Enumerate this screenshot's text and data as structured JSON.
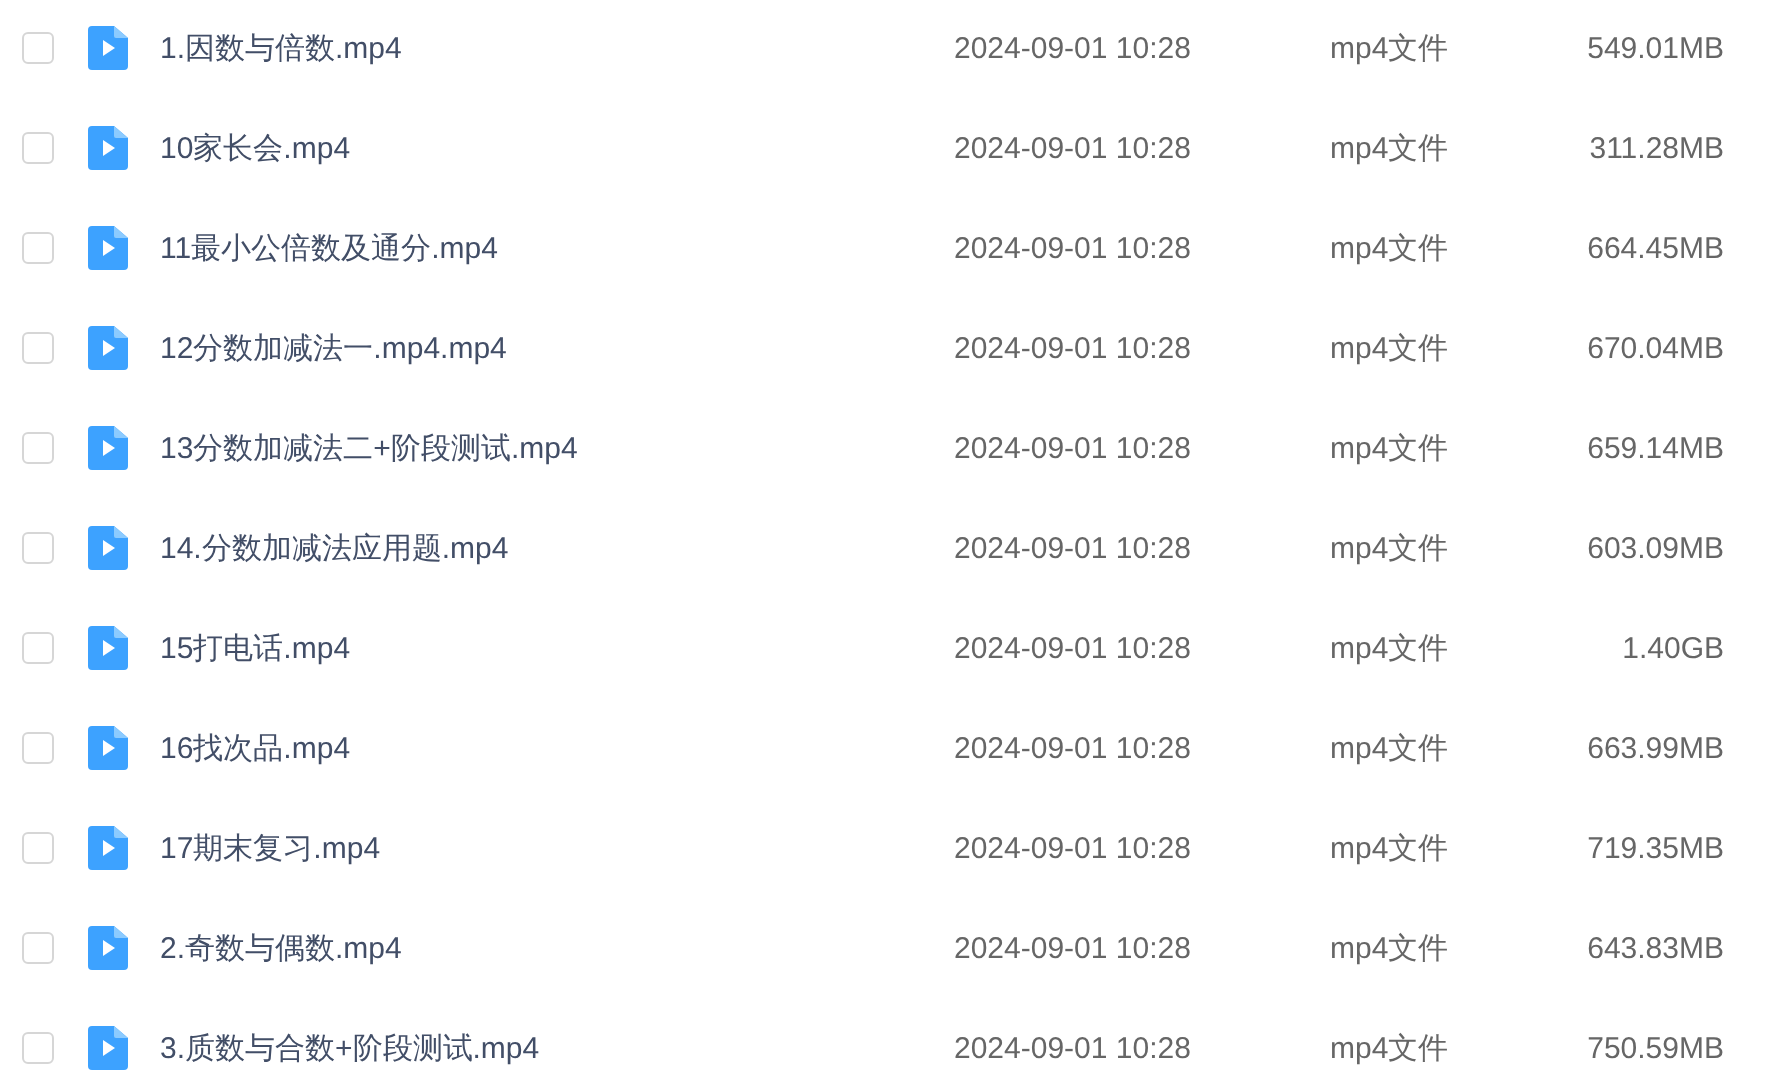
{
  "files": [
    {
      "name": "1.因数与倍数.mp4",
      "modified": "2024-09-01 10:28",
      "type": "mp4文件",
      "size": "549.01MB",
      "checked": false
    },
    {
      "name": "10家长会.mp4",
      "modified": "2024-09-01 10:28",
      "type": "mp4文件",
      "size": "311.28MB",
      "checked": false
    },
    {
      "name": "11最小公倍数及通分.mp4",
      "modified": "2024-09-01 10:28",
      "type": "mp4文件",
      "size": "664.45MB",
      "checked": false
    },
    {
      "name": "12分数加减法一.mp4.mp4",
      "modified": "2024-09-01 10:28",
      "type": "mp4文件",
      "size": "670.04MB",
      "checked": false
    },
    {
      "name": "13分数加减法二+阶段测试.mp4",
      "modified": "2024-09-01 10:28",
      "type": "mp4文件",
      "size": "659.14MB",
      "checked": false
    },
    {
      "name": "14.分数加减法应用题.mp4",
      "modified": "2024-09-01 10:28",
      "type": "mp4文件",
      "size": "603.09MB",
      "checked": false
    },
    {
      "name": "15打电话.mp4",
      "modified": "2024-09-01 10:28",
      "type": "mp4文件",
      "size": "1.40GB",
      "checked": false
    },
    {
      "name": "16找次品.mp4",
      "modified": "2024-09-01 10:28",
      "type": "mp4文件",
      "size": "663.99MB",
      "checked": false
    },
    {
      "name": "17期末复习.mp4",
      "modified": "2024-09-01 10:28",
      "type": "mp4文件",
      "size": "719.35MB",
      "checked": false
    },
    {
      "name": "2.奇数与偶数.mp4",
      "modified": "2024-09-01 10:28",
      "type": "mp4文件",
      "size": "643.83MB",
      "checked": false
    },
    {
      "name": "3.质数与合数+阶段测试.mp4",
      "modified": "2024-09-01 10:28",
      "type": "mp4文件",
      "size": "750.59MB",
      "checked": false
    }
  ]
}
